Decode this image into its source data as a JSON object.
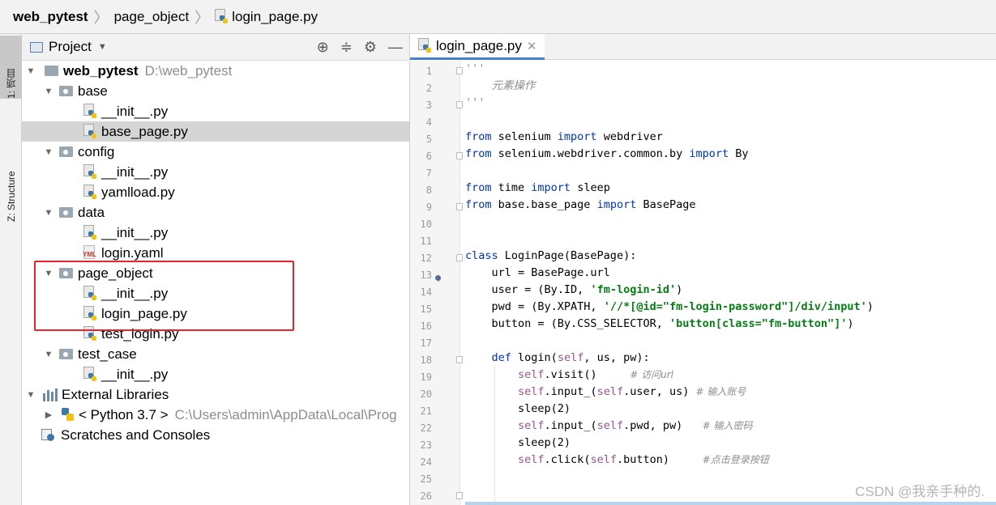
{
  "breadcrumb": {
    "project": "web_pytest",
    "folder": "page_object",
    "file": "login_page.py"
  },
  "tool_tabs": {
    "project": "1: 项目",
    "structure": "Z: Structure"
  },
  "project_panel": {
    "title": "Project",
    "tree": [
      {
        "label": "web_pytest",
        "extra": "D:\\web_pytest",
        "type": "root",
        "expanded": true
      },
      {
        "label": "base",
        "type": "package",
        "expanded": true
      },
      {
        "label": "__init__.py",
        "type": "python"
      },
      {
        "label": "base_page.py",
        "type": "python",
        "selected": true
      },
      {
        "label": "config",
        "type": "package",
        "expanded": true
      },
      {
        "label": "__init__.py",
        "type": "python"
      },
      {
        "label": "yamlload.py",
        "type": "python"
      },
      {
        "label": "data",
        "type": "package",
        "expanded": true
      },
      {
        "label": "__init__.py",
        "type": "python"
      },
      {
        "label": "login.yaml",
        "type": "yaml"
      },
      {
        "label": "page_object",
        "type": "package",
        "expanded": true
      },
      {
        "label": "__init__.py",
        "type": "python"
      },
      {
        "label": "login_page.py",
        "type": "python"
      },
      {
        "label": "test_login.py",
        "type": "python"
      },
      {
        "label": "test_case",
        "type": "package",
        "expanded": true
      },
      {
        "label": "__init__.py",
        "type": "python"
      },
      {
        "label": "External Libraries",
        "type": "library",
        "expanded": true
      },
      {
        "label": "< Python 3.7 >",
        "extra": "C:\\Users\\admin\\AppData\\Local\\Prog",
        "type": "python-sdk",
        "expanded": false
      },
      {
        "label": "Scratches and Consoles",
        "type": "scratches"
      }
    ]
  },
  "editor": {
    "tab_label": "login_page.py",
    "line_numbers": [
      "1",
      "2",
      "3",
      "4",
      "5",
      "6",
      "7",
      "8",
      "9",
      "10",
      "11",
      "12",
      "13",
      "14",
      "15",
      "16",
      "17",
      "18",
      "19",
      "20",
      "21",
      "22",
      "23",
      "24",
      "25",
      "26"
    ],
    "code": {
      "l1": "'''",
      "l2": "    元素操作",
      "l3": "'''",
      "l5a": "from",
      "l5b": " selenium ",
      "l5c": "import",
      "l5d": " webdriver",
      "l6a": "from",
      "l6b": " selenium.webdriver.common.by ",
      "l6c": "import",
      "l6d": " By",
      "l8a": "from",
      "l8b": " time ",
      "l8c": "import",
      "l8d": " sleep",
      "l9a": "from",
      "l9b": " base.base_page ",
      "l9c": "import",
      "l9d": " BasePage",
      "l12a": "class",
      "l12b": " LoginPage(BasePage):",
      "l13": "    url = BasePage.url",
      "l14a": "    user = (By.ID, ",
      "l14b": "'fm-login-id'",
      "l14c": ")",
      "l15a": "    pwd = (By.XPATH, ",
      "l15b": "'//*[@id=\"fm-login-password\"]/div/input'",
      "l15c": ")",
      "l16a": "    button = (By.CSS_SELECTOR, ",
      "l16b": "'button[class=\"fm-button\"]'",
      "l16c": ")",
      "l18a": "    ",
      "l18b": "def",
      "l18c": " login(",
      "l18d": "self",
      "l18e": ", us, pw):",
      "l19a": "        ",
      "l19b": "self",
      "l19c": ".visit()     ",
      "l19d": "# 访问url",
      "l20a": "        ",
      "l20b": "self",
      "l20c": ".input_(",
      "l20d": "self",
      "l20e": ".user, us) ",
      "l20f": "# 输入账号",
      "l21": "        sleep(2)",
      "l22a": "        ",
      "l22b": "self",
      "l22c": ".input_(",
      "l22d": "self",
      "l22e": ".pwd, pw)   ",
      "l22f": "# 输入密码",
      "l23": "        sleep(2)",
      "l24a": "        ",
      "l24b": "self",
      "l24c": ".click(",
      "l24d": "self",
      "l24e": ".button)     ",
      "l24f": "#点击登录按钮"
    }
  },
  "watermark": "CSDN @我亲手种的."
}
